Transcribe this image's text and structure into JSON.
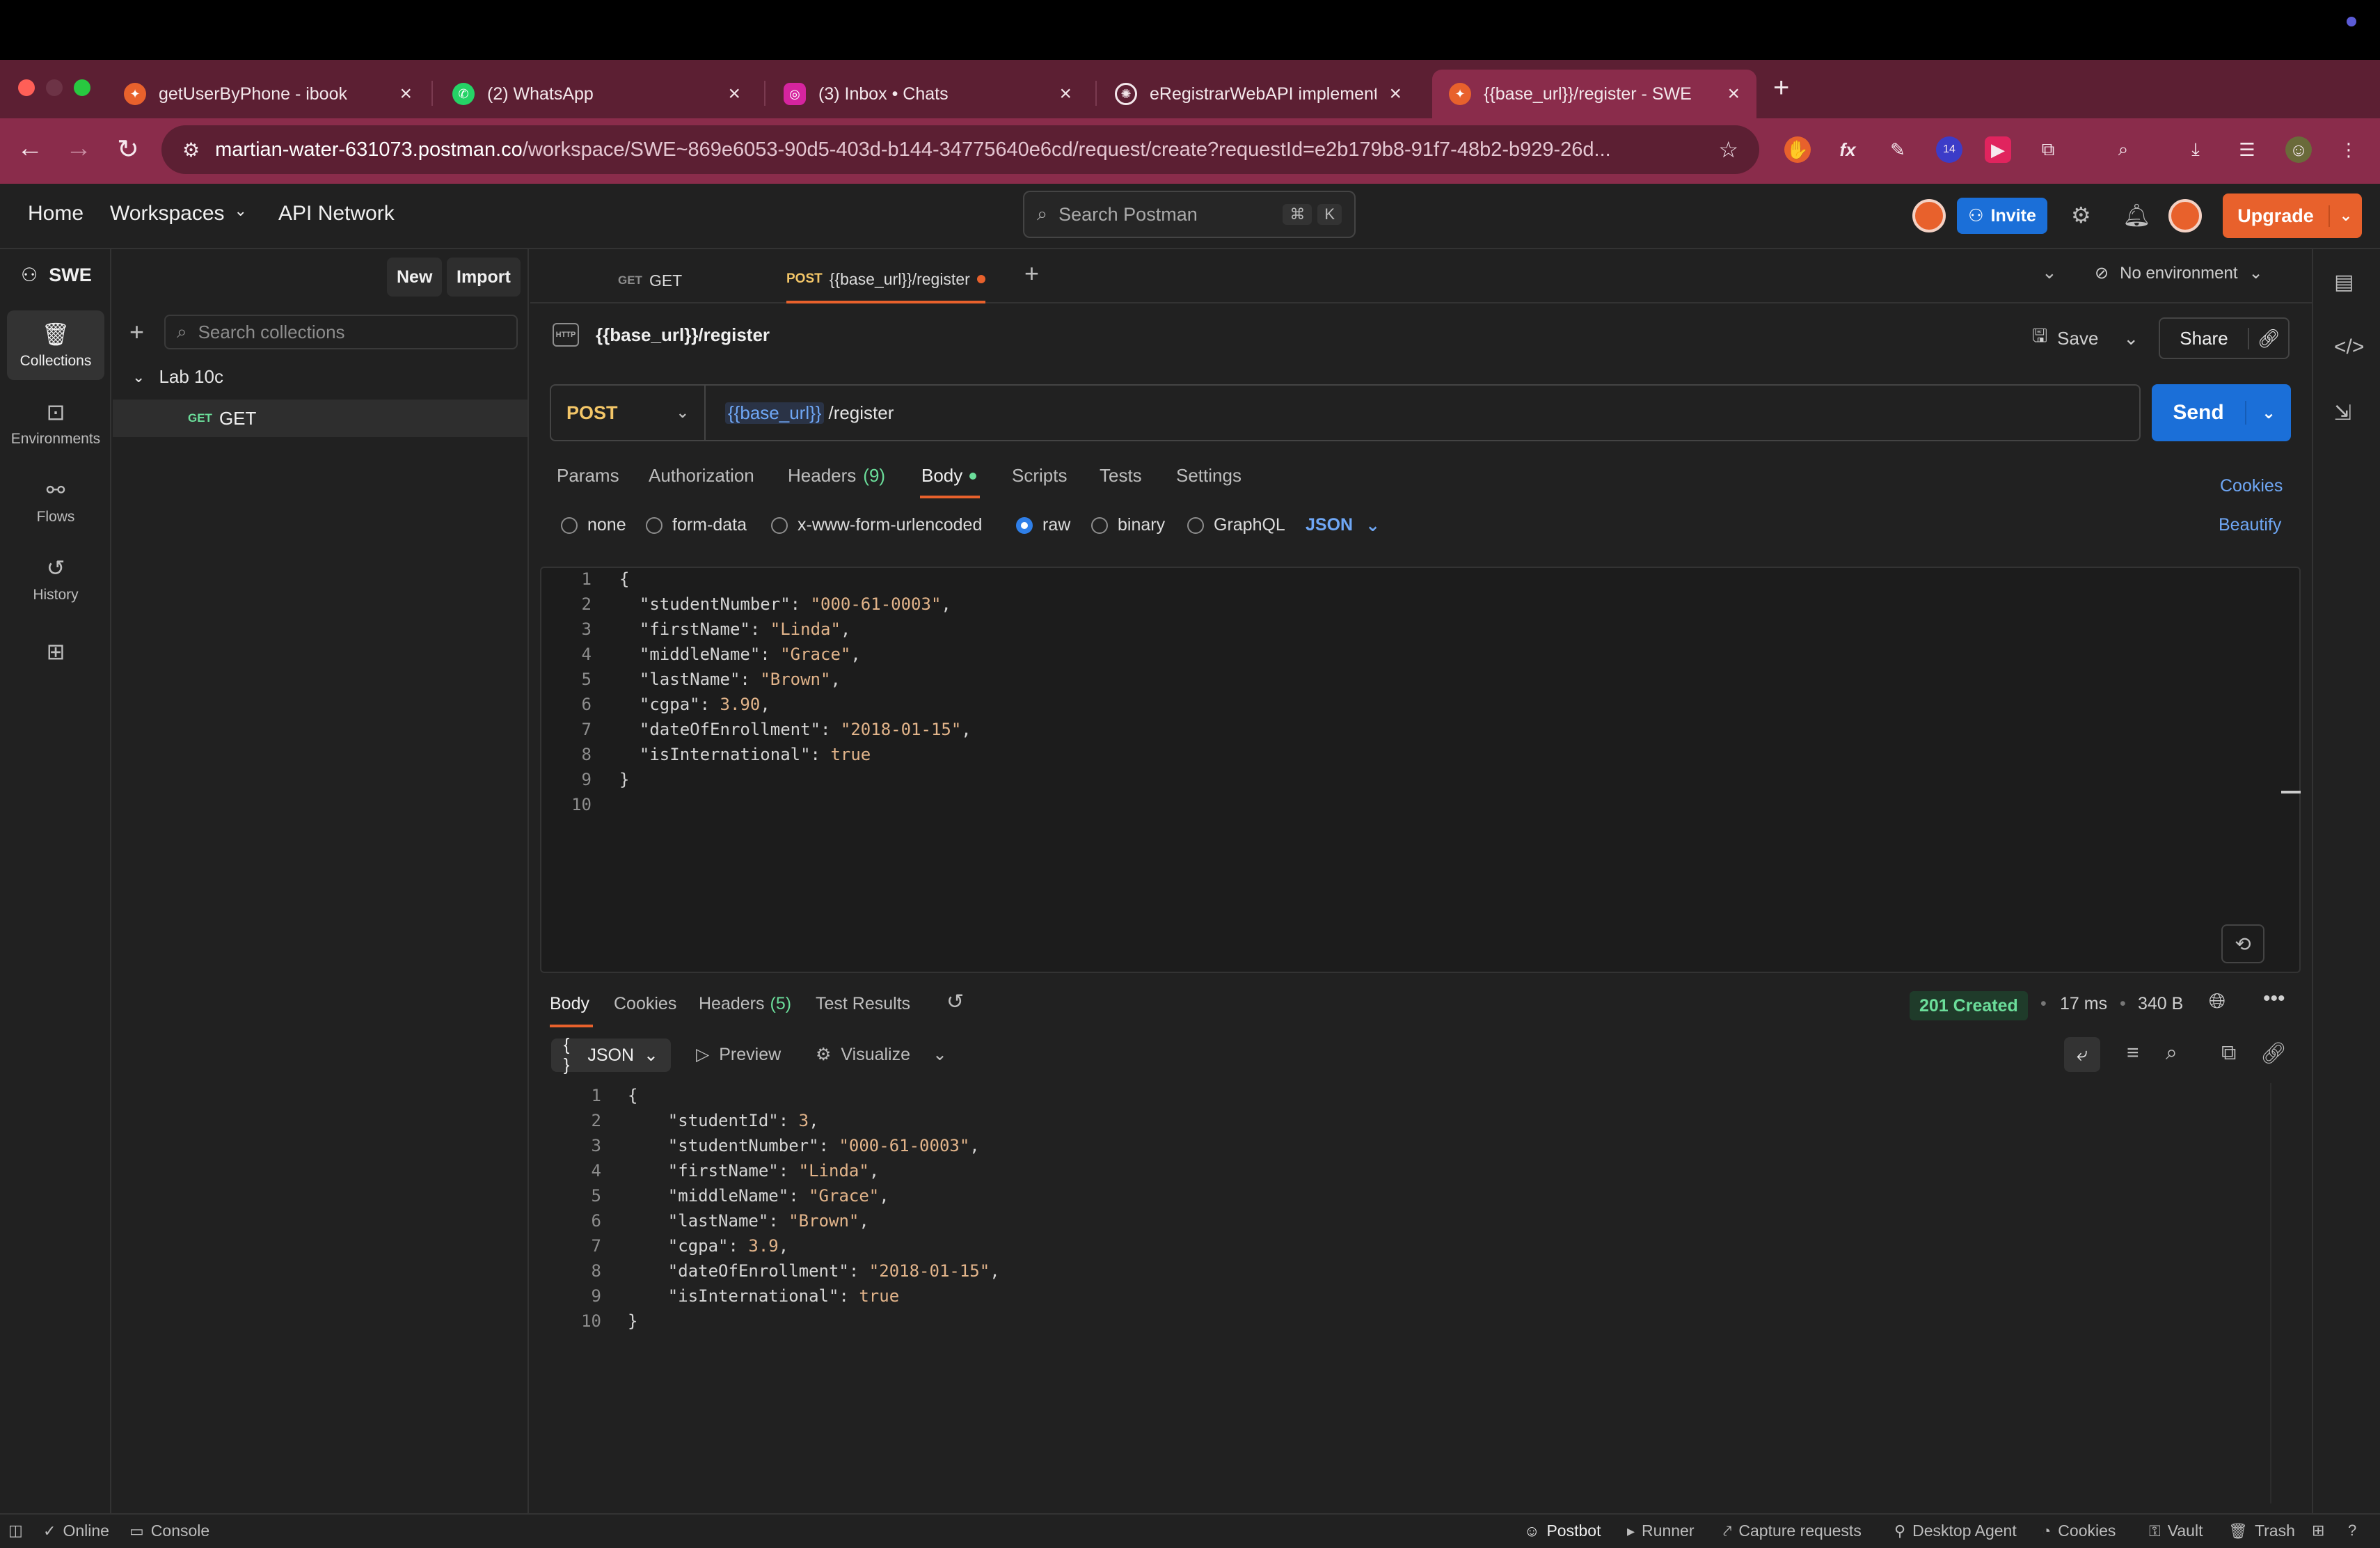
{
  "browser": {
    "tabs": [
      {
        "title": "getUserByPhone - ibook",
        "favicon": "postman-icon",
        "color": "#e8612c"
      },
      {
        "title": "(2) WhatsApp",
        "favicon": "whatsapp-icon",
        "color": "#25d366"
      },
      {
        "title": "(3) Inbox • Chats",
        "favicon": "instagram-icon",
        "color": "#d6249f"
      },
      {
        "title": "eRegistrarWebAPI implement",
        "favicon": "openai-icon",
        "color": "#3b3b3b"
      },
      {
        "title": "{{base_url}}/register - SWE",
        "favicon": "postman-icon",
        "color": "#e8612c",
        "active": true
      }
    ],
    "url_host": "martian-water-631073.postman.co",
    "url_path": "/workspace/SWE~869e6053-90d5-403d-b144-34775640e6cd/request/create?requestId=e2b179b8-91f7-48b2-b929-26d...",
    "extension_badge": "14"
  },
  "header": {
    "nav": [
      "Home",
      "Workspaces",
      "API Network"
    ],
    "search_placeholder": "Search Postman",
    "search_kbd": [
      "⌘",
      "K"
    ],
    "invite": "Invite",
    "upgrade": "Upgrade"
  },
  "workspace": {
    "name": "SWE",
    "new_label": "New",
    "import_label": "Import",
    "rail": [
      {
        "label": "Collections",
        "icon": "collections-icon",
        "active": true
      },
      {
        "label": "Environments",
        "icon": "environments-icon"
      },
      {
        "label": "Flows",
        "icon": "flows-icon"
      },
      {
        "label": "History",
        "icon": "history-icon"
      }
    ],
    "collection_search_placeholder": "Search collections",
    "folder": "Lab 10c",
    "request_method": "GET",
    "request_name": "GET"
  },
  "request_tabs": [
    {
      "method": "GET",
      "name": "GET"
    },
    {
      "method": "POST",
      "name": "{{base_url}}/register",
      "active": true,
      "unsaved": true
    }
  ],
  "environment": "No environment",
  "request": {
    "title": "{{base_url}}/register",
    "save_label": "Save",
    "share_label": "Share",
    "method": "POST",
    "url_var": "{{base_url}}",
    "url_path": "/register",
    "send_label": "Send",
    "subtabs": [
      {
        "label": "Params"
      },
      {
        "label": "Authorization"
      },
      {
        "label": "Headers",
        "count": "(9)"
      },
      {
        "label": "Body",
        "active": true
      },
      {
        "label": "Scripts"
      },
      {
        "label": "Tests"
      },
      {
        "label": "Settings"
      }
    ],
    "cookies_link": "Cookies",
    "beautify_link": "Beautify",
    "body_modes": [
      "none",
      "form-data",
      "x-www-form-urlencoded",
      "raw",
      "binary",
      "GraphQL"
    ],
    "body_mode_selected": "raw",
    "language": "JSON",
    "body_lines": [
      "{",
      "  \"studentNumber\": \"000-61-0003\",",
      "  \"firstName\": \"Linda\",",
      "  \"middleName\": \"Grace\",",
      "  \"lastName\": \"Brown\",",
      "  \"cgpa\": 3.90,",
      "  \"dateOfEnrollment\": \"2018-01-15\",",
      "  \"isInternational\": true",
      "}",
      ""
    ]
  },
  "response": {
    "tabs": [
      {
        "label": "Body",
        "active": true
      },
      {
        "label": "Cookies"
      },
      {
        "label": "Headers",
        "count": "(5)"
      },
      {
        "label": "Test Results"
      }
    ],
    "status": "201 Created",
    "time": "17 ms",
    "size": "340 B",
    "format": "JSON",
    "preview_label": "Preview",
    "visualize_label": "Visualize",
    "body_lines": [
      "{",
      "    \"studentId\": 3,",
      "    \"studentNumber\": \"000-61-0003\",",
      "    \"firstName\": \"Linda\",",
      "    \"middleName\": \"Grace\",",
      "    \"lastName\": \"Brown\",",
      "    \"cgpa\": 3.9,",
      "    \"dateOfEnrollment\": \"2018-01-15\",",
      "    \"isInternational\": true",
      "}"
    ]
  },
  "statusbar": {
    "online": "Online",
    "console": "Console",
    "right": [
      "Postbot",
      "Runner",
      "Capture requests",
      "Desktop Agent",
      "Cookies",
      "Vault",
      "Trash"
    ]
  },
  "colors": {
    "accent": "#e8612c",
    "primary": "#1b6fd8",
    "success": "#6bdd9a",
    "post_method": "#f3c668"
  }
}
